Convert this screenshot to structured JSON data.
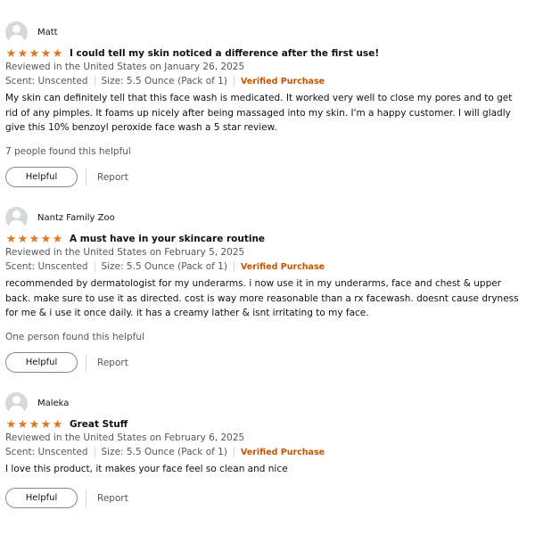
{
  "reviews": [
    {
      "author": "Matt",
      "rating": 5,
      "title": "I could tell my skin noticed a difference after the first use!",
      "date_line": "Reviewed in the United States on January 26, 2025",
      "scent": "Scent: Unscented",
      "size": "Size: 5.5 Ounce (Pack of 1)",
      "verified": "Verified Purchase",
      "body": "My skin can definitely tell that this face wash is medicated. It worked very well to close my pores and to get rid of any pimples. It foams up nicely after being massaged into my skin. I'm a happy customer. I will gladly give this 10% benzoyl peroxide face wash a 5 star review.",
      "helpful_count": "7 people found this helpful",
      "helpful_label": "Helpful",
      "report_label": "Report"
    },
    {
      "author": "Nantz Family Zoo",
      "rating": 5,
      "title": "A must have in your skincare routine",
      "date_line": "Reviewed in the United States on February 5, 2025",
      "scent": "Scent: Unscented",
      "size": "Size: 5.5 Ounce (Pack of 1)",
      "verified": "Verified Purchase",
      "body": "recommended by dermatologist for my underarms. i now use it in my underarms, face and chest & upper back. make sure to use it as directed. cost is way more reasonable than a rx facewash. doesnt cause dryness for me & i use it once daily. it has a creamy lather & isnt irritating to my face.",
      "helpful_count": "One person found this helpful",
      "helpful_label": "Helpful",
      "report_label": "Report"
    },
    {
      "author": "Maleka",
      "rating": 5,
      "title": "Great Stuff",
      "date_line": "Reviewed in the United States on February 6, 2025",
      "scent": "Scent: Unscented",
      "size": "Size: 5.5 Ounce (Pack of 1)",
      "verified": "Verified Purchase",
      "body": "I love this product, it makes your face feel so clean and nice",
      "helpful_label": "Helpful",
      "report_label": "Report"
    }
  ],
  "colors": {
    "star": "#de7921",
    "verified": "#c45500",
    "muted_text": "#565959",
    "avatar": "#d5d9d9"
  },
  "icons": {
    "avatar": "user-silhouette-icon",
    "star": "star-icon"
  }
}
